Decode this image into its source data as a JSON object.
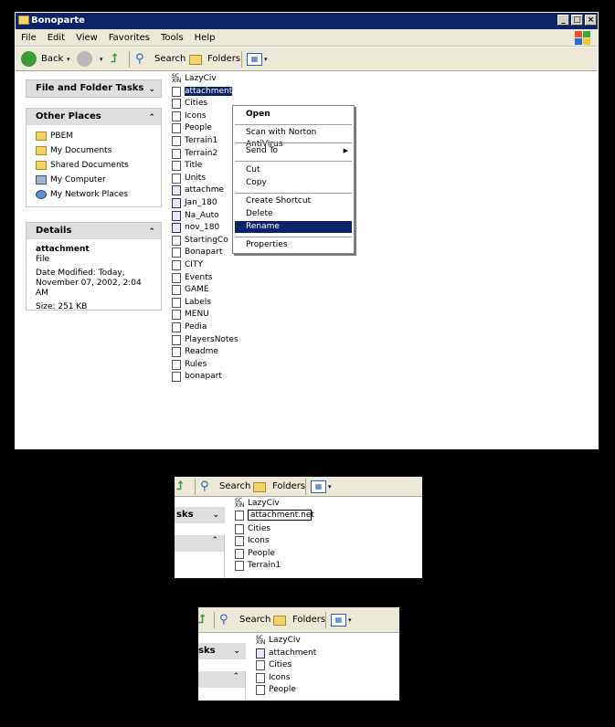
{
  "window": {
    "title": "Bonoparte",
    "menu": [
      "File",
      "Edit",
      "View",
      "Favorites",
      "Tools",
      "Help"
    ],
    "toolbar": {
      "back": "Back",
      "search": "Search",
      "folders": "Folders"
    }
  },
  "taskpane": {
    "file_folder_tasks": "File and Folder Tasks",
    "other_places": {
      "title": "Other Places",
      "items": [
        "PBEM",
        "My Documents",
        "Shared Documents",
        "My Computer",
        "My Network Places"
      ]
    },
    "details": {
      "title": "Details",
      "name": "attachment",
      "type": "File",
      "modified": "Date Modified: Today, November 07, 2002, 2:04 AM",
      "size": "Size: 251 KB"
    }
  },
  "files": [
    {
      "name": "LazyCiv",
      "icon": "xin"
    },
    {
      "name": "attachment",
      "icon": "file"
    },
    {
      "name": "Cities",
      "icon": "file"
    },
    {
      "name": "Icons",
      "icon": "file"
    },
    {
      "name": "People",
      "icon": "file"
    },
    {
      "name": "Terrain1",
      "icon": "file"
    },
    {
      "name": "Terrain2",
      "icon": "file"
    },
    {
      "name": "Title",
      "icon": "file"
    },
    {
      "name": "Units",
      "icon": "file"
    },
    {
      "name": "attachme",
      "icon": "exe"
    },
    {
      "name": "Jan_180",
      "icon": "exe"
    },
    {
      "name": "Na_Auto",
      "icon": "exe"
    },
    {
      "name": "nov_180",
      "icon": "exe"
    },
    {
      "name": "StartingCo",
      "icon": "file"
    },
    {
      "name": "Bonapart",
      "icon": "file"
    },
    {
      "name": "CITY",
      "icon": "file"
    },
    {
      "name": "Events",
      "icon": "file"
    },
    {
      "name": "GAME",
      "icon": "file"
    },
    {
      "name": "Labels",
      "icon": "file"
    },
    {
      "name": "MENU",
      "icon": "file"
    },
    {
      "name": "Pedia",
      "icon": "file"
    },
    {
      "name": "PlayersNotes",
      "icon": "file"
    },
    {
      "name": "Readme",
      "icon": "file"
    },
    {
      "name": "Rules",
      "icon": "file"
    },
    {
      "name": "bonapart",
      "icon": "file"
    }
  ],
  "context_menu": {
    "open": "Open",
    "scan": "Scan with Norton AntiVirus",
    "send_to": "Send To",
    "cut": "Cut",
    "copy": "Copy",
    "create_shortcut": "Create Shortcut",
    "delete": "Delete",
    "rename": "Rename",
    "properties": "Properties"
  },
  "inset1": {
    "search": "Search",
    "folders": "Folders",
    "tasks_fragment": "sks",
    "rename_value": "attachment.net",
    "files": [
      "LazyCiv",
      "Cities",
      "Icons",
      "People",
      "Terrain1"
    ]
  },
  "inset2": {
    "search": "Search",
    "folders": "Folders",
    "tasks_fragment": "sks",
    "files": [
      "LazyCiv",
      "attachment",
      "Cities",
      "Icons",
      "People"
    ]
  }
}
